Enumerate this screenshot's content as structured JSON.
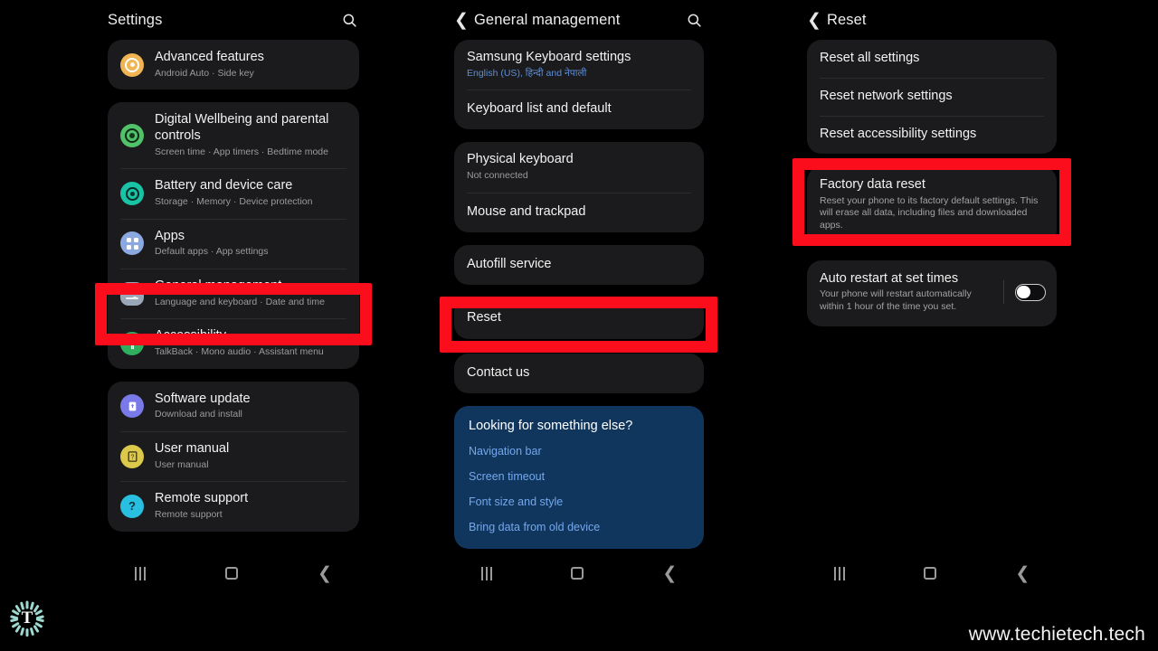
{
  "watermark": {
    "url": "www.techietech.tech",
    "logo_letter": "T"
  },
  "panel1": {
    "title": "Settings",
    "search_icon": "search-icon",
    "groups": [
      {
        "items": [
          {
            "title": "Advanced features",
            "subtitle": "Android Auto  ·  Side key",
            "icon": "advanced-features-icon",
            "color": "#f0b552"
          }
        ]
      },
      {
        "items": [
          {
            "title": "Digital Wellbeing and parental controls",
            "subtitle": "Screen time  ·  App timers  ·  Bedtime mode",
            "icon": "digital-wellbeing-icon",
            "color": "#52c26a"
          },
          {
            "title": "Battery and device care",
            "subtitle": "Storage  ·  Memory  ·  Device protection",
            "icon": "battery-device-care-icon",
            "color": "#19c3a6"
          },
          {
            "title": "Apps",
            "subtitle": "Default apps  ·  App settings",
            "icon": "apps-icon",
            "color": "#8ca8e0"
          },
          {
            "title": "General management",
            "subtitle": "Language and keyboard  ·  Date and time",
            "icon": "general-management-icon",
            "color": "#9aa7b8"
          },
          {
            "title": "Accessibility",
            "subtitle": "TalkBack  ·  Mono audio  ·  Assistant menu",
            "icon": "accessibility-icon",
            "color": "#2faf5d"
          }
        ]
      },
      {
        "items": [
          {
            "title": "Software update",
            "subtitle": "Download and install",
            "icon": "software-update-icon",
            "color": "#7a79e8"
          },
          {
            "title": "User manual",
            "subtitle": "User manual",
            "icon": "user-manual-icon",
            "color": "#dcc84a"
          },
          {
            "title": "Remote support",
            "subtitle": "Remote support",
            "icon": "remote-support-icon",
            "color": "#28bfe0"
          }
        ]
      }
    ]
  },
  "panel2": {
    "title": "General management",
    "back_icon": "back-chevron-icon",
    "search_icon": "search-icon",
    "groups": [
      {
        "items": [
          {
            "title": "Samsung Keyboard settings",
            "subtitle": "English (US), हिन्दी and नेपाली",
            "subtitle_style": "blue"
          },
          {
            "title": "Keyboard list and default",
            "subtitle": ""
          }
        ]
      },
      {
        "items": [
          {
            "title": "Physical keyboard",
            "subtitle": "Not connected"
          },
          {
            "title": "Mouse and trackpad",
            "subtitle": ""
          }
        ]
      },
      {
        "items": [
          {
            "title": "Autofill service",
            "subtitle": ""
          }
        ]
      },
      {
        "items": [
          {
            "title": "Reset",
            "subtitle": ""
          }
        ]
      },
      {
        "items": [
          {
            "title": "Contact us",
            "subtitle": ""
          }
        ]
      }
    ],
    "promo": {
      "title": "Looking for something else?",
      "links": [
        "Navigation bar",
        "Screen timeout",
        "Font size and style",
        "Bring data from old device"
      ]
    }
  },
  "panel3": {
    "title": "Reset",
    "back_icon": "back-chevron-icon",
    "groups": [
      {
        "items": [
          {
            "title": "Reset all settings",
            "subtitle": ""
          },
          {
            "title": "Reset network settings",
            "subtitle": ""
          },
          {
            "title": "Reset accessibility settings",
            "subtitle": ""
          }
        ]
      },
      {
        "items": [
          {
            "title": "Factory data reset",
            "subtitle": "Reset your phone to its factory default settings. This will erase all data, including files and downloaded apps."
          }
        ]
      },
      {
        "items": [
          {
            "title": "Auto restart at set times",
            "subtitle": "Your phone will restart automatically within 1 hour of the time you set.",
            "toggle": "off"
          }
        ]
      }
    ]
  },
  "navbar": {
    "recents": "recents-icon",
    "home": "home-icon",
    "back": "back-icon"
  },
  "highlights": {
    "color": "#fc0d1b",
    "targets": [
      "General management",
      "Reset",
      "Factory data reset"
    ]
  }
}
